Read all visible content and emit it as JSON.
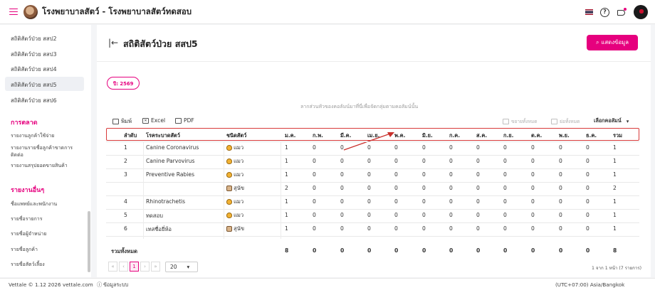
{
  "header": {
    "app_title": "โรงพยาบาลสัตว์ - โรงพยาบาลสัตว์ทดสอบ"
  },
  "sidebar": {
    "items": [
      {
        "label": "สถิติสัตว์ป่วย สสป2"
      },
      {
        "label": "สถิติสัตว์ป่วย สสป3"
      },
      {
        "label": "สถิติสัตว์ป่วย สสป4"
      },
      {
        "label": "สถิติสัตว์ป่วย สสป5",
        "active": true
      },
      {
        "label": "สถิติสัตว์ป่วย สสป6"
      }
    ],
    "section_marketing": "การตลาด",
    "marketing_items": [
      {
        "label": "รายงานลูกค้าใช้จ่าย"
      },
      {
        "label": "รายงานรายชื่อลูกค้าขาดการติดต่อ"
      },
      {
        "label": "รายงานสรุปยอดขายสินค้า"
      }
    ],
    "section_other": "รายงานอื่นๆ",
    "other_items": [
      {
        "label": "ชื่อแพทย์และพนักงาน"
      },
      {
        "label": "รายชื่อรายการ"
      },
      {
        "label": "รายชื่อผู้จำหน่าย"
      },
      {
        "label": "รายชื่อลูกค้า"
      },
      {
        "label": "รายชื่อสัตว์เลี้ยง"
      }
    ]
  },
  "main": {
    "title": "สถิติสัตว์ป่วย สสป5",
    "show_data_button": "แสดงข้อมูล",
    "year_chip": "ปี: 2569",
    "group_hint": "ลากส่วนหัวของคอลัมน์มาที่นี่เพื่อจัดกลุ่มตามคอลัมน์นั้น",
    "toolbar": {
      "print": "พิมพ์",
      "excel": "Excel",
      "pdf": "PDF",
      "expand_all": "ขยายทั้งหมด",
      "collapse_all": "ย่อทั้งหมด",
      "choose_columns": "เลือกคอลัมน์"
    }
  },
  "table": {
    "columns": [
      "ลำดับ",
      "โรคระบาดสัตว์",
      "ชนิดสัตว์",
      "ม.ค.",
      "ก.พ.",
      "มี.ค.",
      "เม.ย.",
      "พ.ค.",
      "มิ.ย.",
      "ก.ค.",
      "ส.ค.",
      "ก.ย.",
      "ต.ค.",
      "พ.ย.",
      "ธ.ค.",
      "รวม"
    ],
    "rows": [
      {
        "no": "1",
        "disease": "Canine Coronavirus",
        "animal": "แมว",
        "animal_icon": "cat-icon",
        "months": [
          "1",
          "0",
          "0",
          "0",
          "0",
          "0",
          "0",
          "0",
          "0",
          "0",
          "0",
          "0"
        ],
        "total": "1"
      },
      {
        "no": "2",
        "disease": "Canine Parvovirus",
        "animal": "แมว",
        "animal_icon": "cat-icon",
        "months": [
          "1",
          "0",
          "0",
          "0",
          "0",
          "0",
          "0",
          "0",
          "0",
          "0",
          "0",
          "0"
        ],
        "total": "1"
      },
      {
        "no": "3",
        "disease": "Preventive Rabies",
        "animal": "แมว",
        "animal_icon": "cat-icon",
        "months": [
          "1",
          "0",
          "0",
          "0",
          "0",
          "0",
          "0",
          "0",
          "0",
          "0",
          "0",
          "0"
        ],
        "total": "1"
      },
      {
        "no": "",
        "disease": "",
        "animal": "สุนัข",
        "animal_icon": "dog-icon",
        "months": [
          "2",
          "0",
          "0",
          "0",
          "0",
          "0",
          "0",
          "0",
          "0",
          "0",
          "0",
          "0"
        ],
        "total": "2"
      },
      {
        "no": "4",
        "disease": "Rhinotrachetis",
        "animal": "แมว",
        "animal_icon": "cat-icon",
        "months": [
          "1",
          "0",
          "0",
          "0",
          "0",
          "0",
          "0",
          "0",
          "0",
          "0",
          "0",
          "0"
        ],
        "total": "1"
      },
      {
        "no": "5",
        "disease": "ทดสอบ",
        "animal": "แมว",
        "animal_icon": "cat-icon",
        "months": [
          "1",
          "0",
          "0",
          "0",
          "0",
          "0",
          "0",
          "0",
          "0",
          "0",
          "0",
          "0"
        ],
        "total": "1"
      },
      {
        "no": "6",
        "disease": "เทสชื่อยี่ห้อ",
        "animal": "สุนัข",
        "animal_icon": "dog-icon",
        "months": [
          "1",
          "0",
          "0",
          "0",
          "0",
          "0",
          "0",
          "0",
          "0",
          "0",
          "0",
          "0"
        ],
        "total": "1"
      }
    ],
    "summary_label": "รวมทั้งหมด",
    "summary_values": [
      "8",
      "0",
      "0",
      "0",
      "0",
      "0",
      "0",
      "0",
      "0",
      "0",
      "0",
      "0",
      "8"
    ]
  },
  "pager": {
    "first": "«",
    "prev": "‹",
    "current": "1",
    "next": "›",
    "last": "»",
    "page_size": "20",
    "info": "1 จาก 1 หน้า (7 รายการ)"
  },
  "footer": {
    "version": "Vettale © 1.12 2026",
    "site": "vettale.com",
    "system_info": "ข้อมูลระบบ",
    "timezone": "(UTC+07:00) Asia/Bangkok"
  },
  "colors": {
    "accent": "#e6007e",
    "highlight_box": "#d83a3a",
    "annotation_arrow": "#c9302c"
  }
}
